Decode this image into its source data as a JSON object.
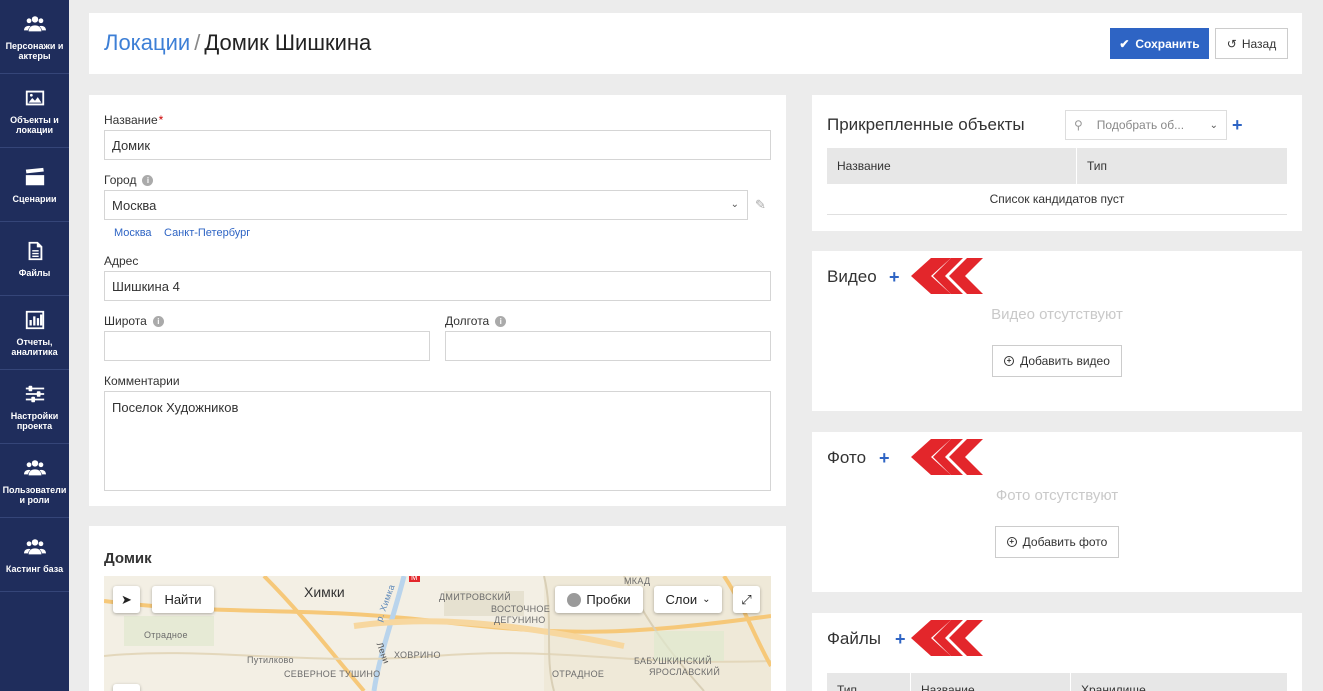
{
  "sidebar": {
    "items": [
      {
        "label": "Персонажи и актеры",
        "icon": "people-icon"
      },
      {
        "label": "Объекты и локации",
        "icon": "image-icon"
      },
      {
        "label": "Сценарии",
        "icon": "clapperboard-icon"
      },
      {
        "label": "Файлы",
        "icon": "file-icon"
      },
      {
        "label": "Отчеты, аналитика",
        "icon": "bar-chart-icon"
      },
      {
        "label": "Настройки проекта",
        "icon": "sliders-icon"
      },
      {
        "label": "Пользователи и роли",
        "icon": "people-icon"
      },
      {
        "label": "Кастинг база",
        "icon": "people-icon"
      }
    ]
  },
  "header": {
    "breadcrumb": "Локации",
    "separator": "/",
    "title": "Домик Шишкина",
    "save_label": "Сохранить",
    "back_label": "Назад"
  },
  "form": {
    "name_label": "Название",
    "name_required": "*",
    "name_value": "Домик",
    "city_label": "Город",
    "city_value": "Москва",
    "city_suggestions": [
      "Москва",
      "Санкт-Петербург"
    ],
    "address_label": "Адрес",
    "address_value": "Шишкина 4",
    "latitude_label": "Широта",
    "latitude_value": "",
    "longitude_label": "Долгота",
    "longitude_value": "",
    "comments_label": "Комментарии",
    "comments_value": "Поселок Художников"
  },
  "map": {
    "title": "Домик",
    "find_button": "Найти",
    "traffic_button": "Пробки",
    "layers_button": "Слои",
    "labels": {
      "khimki": "Химки",
      "dmitrovsky": "ДМИТРОВСКИЙ",
      "vostochnoe_degunino": "ВОСТОЧНОЕ",
      "degunino": "ДЕГУНИНО",
      "mkad": "МКАД",
      "otradnoe_w": "Отрадное",
      "putilkovo": "Путилково",
      "severnoe_tushino": "СЕВЕРНОЕ ТУШИНО",
      "khovrino": "ХОВРИНО",
      "otradnoe": "ОТРАДНОЕ",
      "babushkinsky": "БАБУШКИНСКИЙ",
      "yaroslavsky": "ЯРОСЛАВСКИЙ",
      "river": "р. Химка",
      "leningradskoe": "Лени",
      "m_marker": "М"
    }
  },
  "attached": {
    "title": "Прикрепленные объекты",
    "search_placeholder": "Подобрать об...",
    "columns": [
      "Название",
      "Тип"
    ],
    "empty_text": "Список кандидатов пуст"
  },
  "video": {
    "title": "Видео",
    "empty_text": "Видео отсутствуют",
    "add_label": "Добавить видео"
  },
  "photo": {
    "title": "Фото",
    "empty_text": "Фото отсутствуют",
    "add_label": "Добавить фото"
  },
  "files": {
    "title": "Файлы",
    "columns": [
      "Тип",
      "Название",
      "Хранилище"
    ]
  },
  "colors": {
    "sidebar": "#1f2d5c",
    "accent": "#2e64c4",
    "arrows": "#e3262b"
  }
}
